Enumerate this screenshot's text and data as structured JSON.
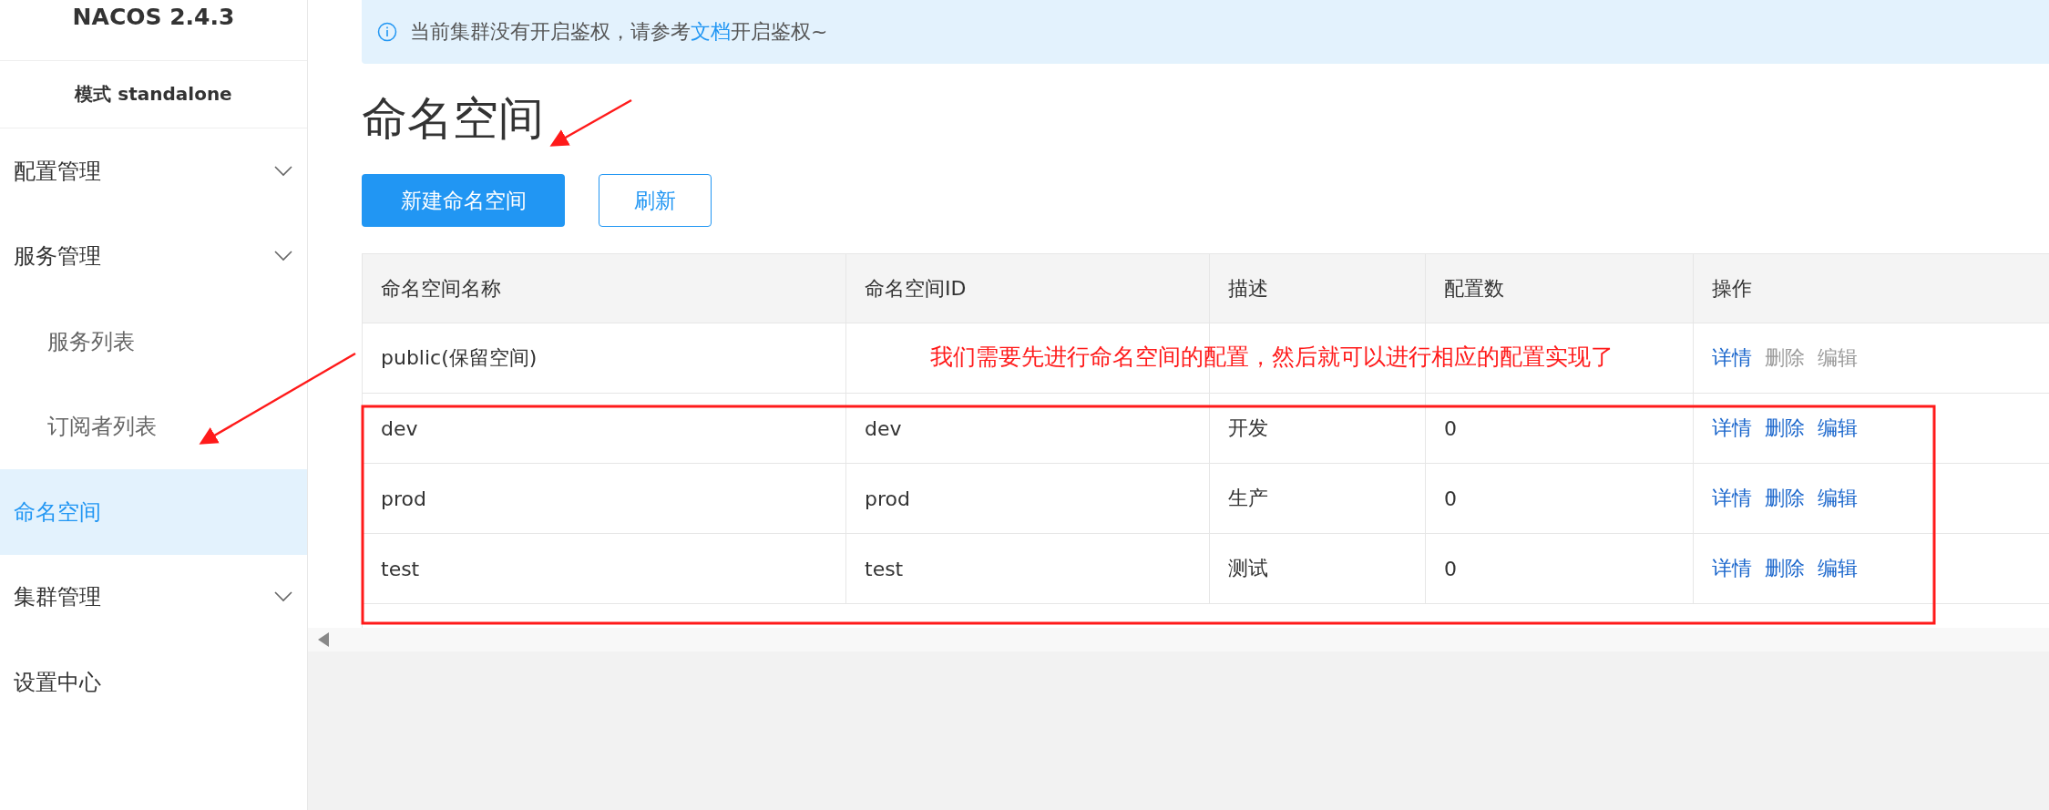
{
  "sidebar": {
    "brand": "NACOS 2.4.3",
    "mode": "模式 standalone",
    "items": [
      {
        "label": "配置管理",
        "kind": "group",
        "selected": false
      },
      {
        "label": "服务管理",
        "kind": "group",
        "selected": false
      },
      {
        "label": "服务列表",
        "kind": "sub",
        "selected": false
      },
      {
        "label": "订阅者列表",
        "kind": "sub",
        "selected": false
      },
      {
        "label": "命名空间",
        "kind": "item",
        "selected": true
      },
      {
        "label": "集群管理",
        "kind": "group",
        "selected": false
      },
      {
        "label": "设置中心",
        "kind": "item",
        "selected": false
      }
    ]
  },
  "notice": {
    "before": "当前集群没有开启鉴权，请参考",
    "link": "文档",
    "after": "开启鉴权~"
  },
  "page_title": "命名空间",
  "buttons": [
    {
      "label": "新建命名空间",
      "kind": "primary"
    },
    {
      "label": "刷新",
      "kind": "secondary"
    }
  ],
  "table": {
    "columns": [
      "命名空间名称",
      "命名空间ID",
      "描述",
      "配置数",
      "操作"
    ],
    "rows": [
      {
        "name": "public(保留空间)",
        "id": "",
        "description": "",
        "count": "",
        "actions": [
          {
            "label": "详情",
            "disabled": false
          },
          {
            "label": "删除",
            "disabled": true
          },
          {
            "label": "编辑",
            "disabled": true
          }
        ]
      },
      {
        "name": "dev",
        "id": "dev",
        "description": "开发",
        "count": "0",
        "actions": [
          {
            "label": "详情",
            "disabled": false
          },
          {
            "label": "删除",
            "disabled": false
          },
          {
            "label": "编辑",
            "disabled": false
          }
        ]
      },
      {
        "name": "prod",
        "id": "prod",
        "description": "生产",
        "count": "0",
        "actions": [
          {
            "label": "详情",
            "disabled": false
          },
          {
            "label": "删除",
            "disabled": false
          },
          {
            "label": "编辑",
            "disabled": false
          }
        ]
      },
      {
        "name": "test",
        "id": "test",
        "description": "测试",
        "count": "0",
        "actions": [
          {
            "label": "详情",
            "disabled": false
          },
          {
            "label": "删除",
            "disabled": false
          },
          {
            "label": "编辑",
            "disabled": false
          }
        ]
      }
    ]
  },
  "annotation": {
    "note": "我们需要先进行命名空间的配置，然后就可以进行相应的配置实现了"
  }
}
